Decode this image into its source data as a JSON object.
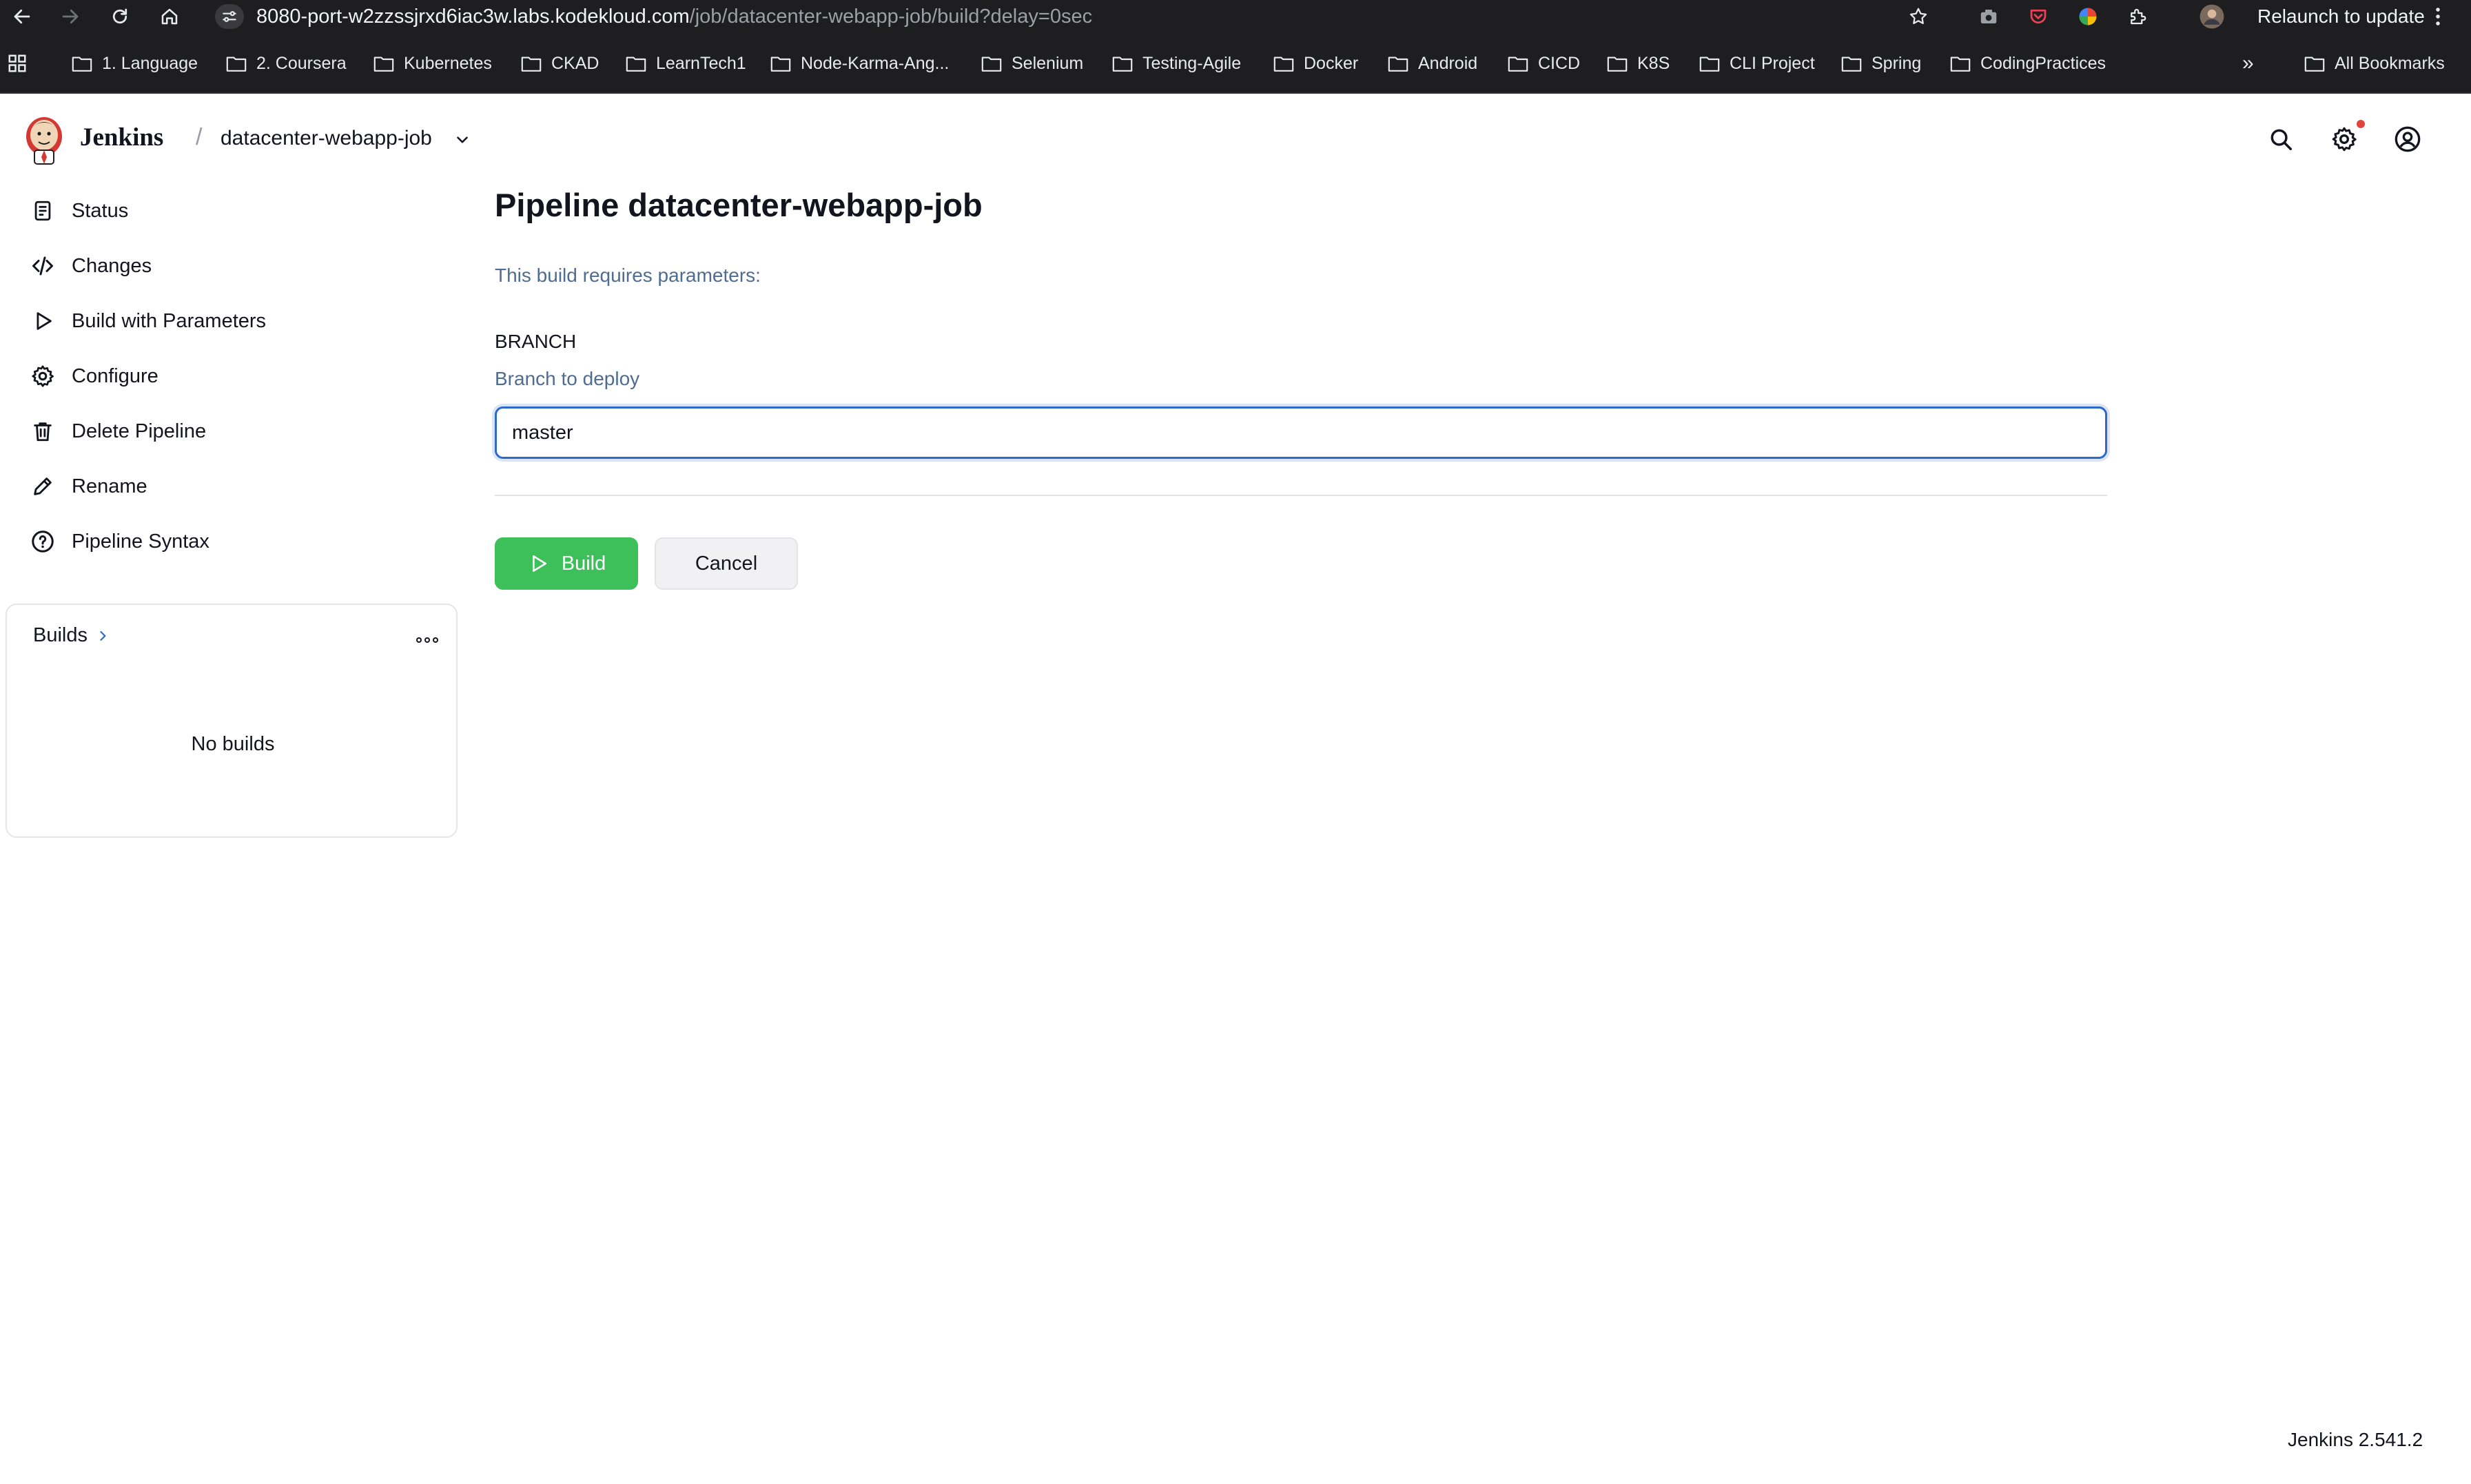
{
  "browser": {
    "url_host": "8080-port-w2zzssjrxd6iac3w.labs.kodekloud.com",
    "url_path": "/job/datacenter-webapp-job/build?delay=0sec",
    "relaunch_label": "Relaunch to update",
    "icons": [
      "back-icon",
      "forward-icon",
      "reload-icon",
      "home-icon",
      "site-info-icon",
      "star-icon",
      "camera-icon",
      "pocket-icon",
      "color-wheel-icon",
      "extensions-icon",
      "profile-avatar",
      "kebab-menu-icon",
      "apps-grid-icon"
    ]
  },
  "bookmarks": {
    "items": [
      "1. Language",
      "2. Coursera",
      "Kubernetes",
      "CKAD",
      "LearnTech1",
      "Node-Karma-Ang...",
      "Selenium",
      "Testing-Agile",
      "Docker",
      "Android",
      "CICD",
      "K8S",
      "CLI Project",
      "Spring",
      "CodingPractices"
    ],
    "all_bookmarks": "All Bookmarks",
    "overflow": "»"
  },
  "header": {
    "brand": "Jenkins",
    "separator": "/",
    "job_name": "datacenter-webapp-job",
    "notification_color": "#e0443c"
  },
  "sidebar": {
    "items": [
      {
        "label": "Status",
        "icon": "document-icon"
      },
      {
        "label": "Changes",
        "icon": "code-icon"
      },
      {
        "label": "Build with Parameters",
        "icon": "play-icon"
      },
      {
        "label": "Configure",
        "icon": "gear-icon"
      },
      {
        "label": "Delete Pipeline",
        "icon": "trash-icon"
      },
      {
        "label": "Rename",
        "icon": "pencil-icon"
      },
      {
        "label": "Pipeline Syntax",
        "icon": "help-circle-icon"
      }
    ],
    "builds": {
      "title": "Builds",
      "empty": "No builds"
    }
  },
  "main": {
    "title": "Pipeline datacenter-webapp-job",
    "requires_text": "This build requires parameters:",
    "param": {
      "name": "BRANCH",
      "description": "Branch to deploy",
      "value": "master"
    },
    "build_label": "Build",
    "cancel_label": "Cancel",
    "accent_color": "#3dbf59"
  },
  "footer": {
    "version": "Jenkins 2.541.2"
  }
}
